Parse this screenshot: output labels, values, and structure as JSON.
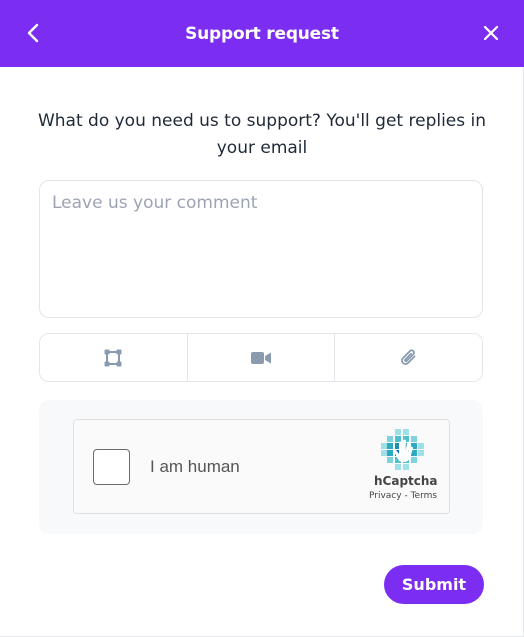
{
  "header": {
    "title": "Support request",
    "back_icon": "chevron-left-icon",
    "close_icon": "close-icon",
    "background_color": "#7c2df2"
  },
  "prompt": {
    "text": "What do you need us to support? You'll get replies in your email"
  },
  "comment": {
    "placeholder": "Leave us your comment",
    "value": ""
  },
  "attachments": {
    "buttons": [
      {
        "icon": "screenshot-crop-icon"
      },
      {
        "icon": "video-camera-icon"
      },
      {
        "icon": "paperclip-icon"
      }
    ],
    "icon_color": "#8a9bb0"
  },
  "captcha": {
    "label": "I am human",
    "brand": "hCaptcha",
    "privacy_label": "Privacy",
    "separator": " - ",
    "terms_label": "Terms",
    "checked": false
  },
  "submit": {
    "label": "Submit",
    "color": "#7c2df2"
  }
}
